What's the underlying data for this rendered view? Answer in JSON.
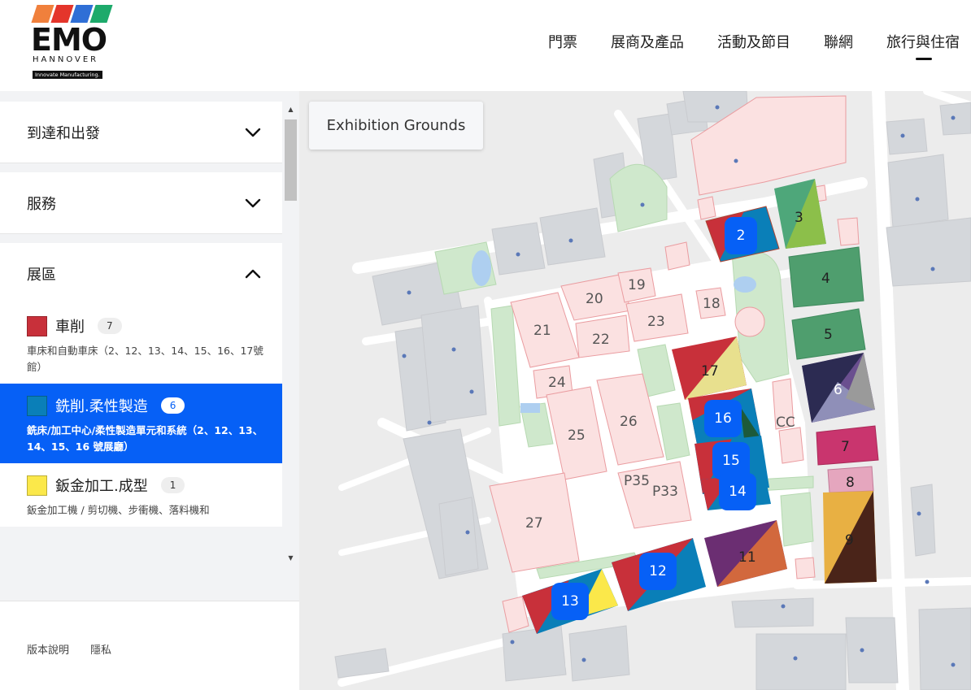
{
  "brand": {
    "logo_word": "EMO",
    "logo_sub": "HANNOVER",
    "logo_tag": "Innovate Manufacturing.",
    "stripe_colors": [
      "#f0803c",
      "#e4352b",
      "#2f6fd6",
      "#1daa6b"
    ]
  },
  "nav": {
    "items": [
      "門票",
      "展商及產品",
      "活動及節目",
      "聯網",
      "旅行與住宿"
    ],
    "active_index": 4
  },
  "sidebar": {
    "sections": [
      {
        "title": "到達和出發",
        "expanded": false
      },
      {
        "title": "服務",
        "expanded": false
      },
      {
        "title": "展區",
        "expanded": true
      }
    ],
    "categories": [
      {
        "name": "車削",
        "count": "7",
        "color": "#c8303a",
        "desc": "車床和自動車床（2、12、13、14、15、16、17號館）",
        "selected": false
      },
      {
        "name": "銑削.柔性製造",
        "count": "6",
        "color": "#0a7fb8",
        "desc": "銑床/加工中心/柔性製造單元和系統（2、12、13、14、15、16 號展廳）",
        "selected": true
      },
      {
        "name": "鈑金加工.成型",
        "count": "1",
        "color": "#fbe84a",
        "desc": "鈑金加工機 / 剪切機、步衝機、落料機和",
        "selected": false
      }
    ],
    "footer": {
      "imprint": "版本說明",
      "privacy": "隱私"
    }
  },
  "map": {
    "title": "Exhibition Grounds",
    "halls": [
      "2",
      "3",
      "4",
      "5",
      "6",
      "7",
      "8",
      "9",
      "11",
      "12",
      "13",
      "14",
      "15",
      "16",
      "17",
      "18",
      "19",
      "20",
      "21",
      "22",
      "23",
      "24",
      "25",
      "26",
      "27",
      "P33",
      "P35",
      "CC"
    ],
    "markers": [
      "2",
      "16",
      "15",
      "14",
      "12",
      "13"
    ]
  }
}
